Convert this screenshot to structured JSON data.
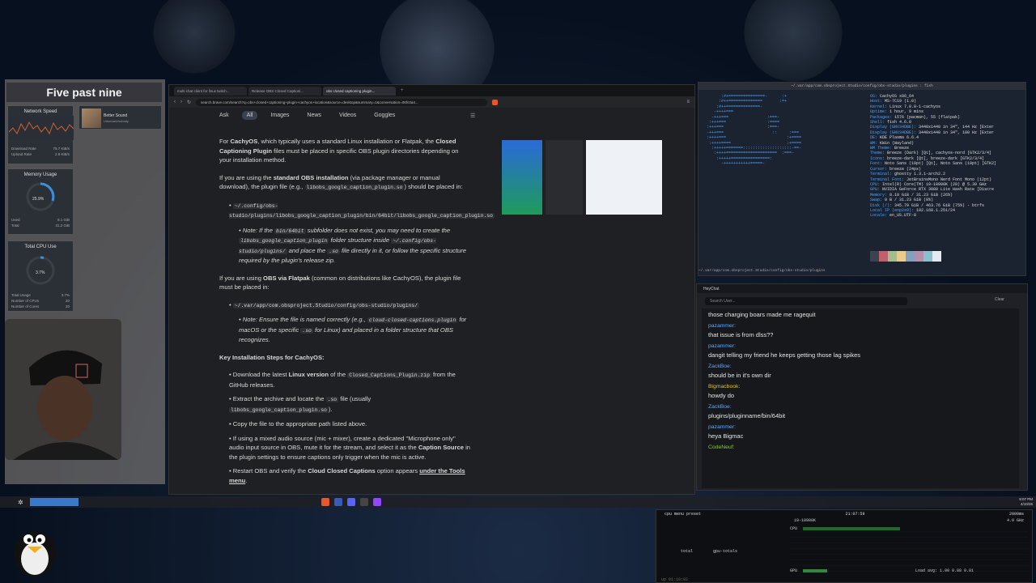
{
  "clock": "Five past nine",
  "network": {
    "title": "Network Speed",
    "download_label": "Download Rate",
    "download_value": "75.7 KiB/s",
    "upload_label": "Upload Rate",
    "upload_value": "2.8 KiB/s"
  },
  "music": {
    "title": "Better Sound",
    "subtitle": "Unknown/nobody"
  },
  "memory": {
    "title": "Memory Usage",
    "percent": "25.9%",
    "used_label": "Used",
    "used_value": "8.1 GiB",
    "total_label": "Total",
    "total_value": "31.2 GiB"
  },
  "cpu_widget": {
    "title": "Total CPU Use",
    "percent": "3.7%",
    "rows": [
      {
        "label": "Total Usage",
        "value": "3.7%"
      },
      {
        "label": "Number of CPUs",
        "value": "20"
      },
      {
        "label": "Number of Cores",
        "value": "20"
      }
    ]
  },
  "browser": {
    "tabs": [
      "multi chat client for linux twitch...",
      "Release OBS Closed Captioni...",
      "obs closed captioning plugin..."
    ],
    "url": "search.brave.com/search?q=obs+closed+captioning+plugin+cachyos+location&source=desktop&summary=1&conversation=06fc0a4...",
    "nav": [
      "Ask",
      "All",
      "Images",
      "News",
      "Videos",
      "Goggles"
    ],
    "article": {
      "p1_pre": "For ",
      "p1_b1": "CachyOS",
      "p1_mid": ", which typically uses a standard Linux installation or Flatpak, the ",
      "p1_b2": "Closed Captioning Plugin",
      "p1_post": " files must be placed in specific OBS plugin directories depending on your installation method.",
      "p2_pre": "If you are using the ",
      "p2_b": "standard OBS installation",
      "p2_mid": " (via package manager or manual download), the plugin file (e.g., ",
      "p2_code": "libobs_google_caption_plugin.so",
      "p2_post": ") should be placed in:",
      "b1_code": "~/.config/obs-studio/plugins/libobs_google_caption_plugin/bin/64bit/libobs_google_caption_plugin.so",
      "n1_a": "Note: If the ",
      "n1_c1": "bin/64bit",
      "n1_b": " subfolder does not exist, you may need to create the ",
      "n1_c2": "libobs_google_caption_plugin",
      "n1_c": " folder structure inside ",
      "n1_c3": "~/.config/obs-studio/plugins/",
      "n1_d": " and place the ",
      "n1_c4": ".so",
      "n1_e": " file directly in it, or follow the specific structure required by the plugin's release zip.",
      "p3_pre": "If you are using ",
      "p3_b": "OBS via Flatpak",
      "p3_post": " (common on distributions like CachyOS), the plugin file must be placed in:",
      "b2_code": "~/.var/app/com.obsproject.Studio/config/obs-studio/plugins/",
      "n2_a": "Note: Ensure the file is named correctly (e.g., ",
      "n2_c1": "cloud-closed-captions.plugin",
      "n2_b": " for macOS or the specific ",
      "n2_c2": ".so",
      "n2_c": " for Linux) and placed in a folder structure that OBS recognizes.",
      "steps_title": "Key Installation Steps for CachyOS:",
      "s1_a": "Download the latest ",
      "s1_b": "Linux version",
      "s1_c": " of the ",
      "s1_code": "Closed_Captions_Plugin.zip",
      "s1_d": " from the GitHub releases.",
      "s2_a": "Extract the archive and locate the ",
      "s2_c1": ".so",
      "s2_b": " file (usually ",
      "s2_c2": "libobs_google_caption_plugin.so",
      "s2_d": ").",
      "s3": "Copy the file to the appropriate path listed above.",
      "s4_a": "If using a mixed audio source (mic + mixer), create a dedicated \"Microphone only\" audio input source in OBS, mute it for the stream, and select it as the ",
      "s4_b": "Caption Source",
      "s4_c": " in the plugin settings to ensure captions only trigger when the mic is active.",
      "s5_a": "Restart OBS and verify the ",
      "s5_b": "Cloud Closed Captions",
      "s5_c": " option appears ",
      "s5_u": "under the Tools menu",
      "s5_d": "."
    }
  },
  "terminal": {
    "title": "~/.var/app/com.obsproject.Studio/config/obs-studio/plugins : fish",
    "info": [
      [
        "OS:",
        "CachyOS x86_64"
      ],
      [
        "Host:",
        "MS-7C19 (1.0)"
      ],
      [
        "Kernel:",
        "Linux 7.0.0-1-cachyos"
      ],
      [
        "Uptime:",
        "1 hour, 9 mins"
      ],
      [
        "Packages:",
        "1576 (pacman), 55 (flatpak)"
      ],
      [
        "Shell:",
        "fish 4.6.0"
      ],
      [
        "Display (GNV34DBE):",
        "3440x1440 in 34\", 144 Hz [Exter"
      ],
      [
        "Display (GNV34DBE):",
        "3440x1440 in 34\", 100 Hz [Exter"
      ],
      [
        "DE:",
        "KDE Plasma 6.6.4"
      ],
      [
        "WM:",
        "KWin (Wayland)"
      ],
      [
        "WM Theme:",
        "Breeze"
      ],
      [
        "Theme:",
        "Breeze (Dark) [Qt], cachyos-nord [GTK2/3/4]"
      ],
      [
        "Icons:",
        "breeze-dark [Qt], breeze-dark [GTK2/3/4]"
      ],
      [
        "Font:",
        "Noto Sans (10pt) [Qt], Noto Sans (10pt) [GTK2]"
      ],
      [
        "Cursor:",
        "breeze (24px)"
      ],
      [
        "Terminal:",
        "ghostty 1.3.1-arch2.2"
      ],
      [
        "Terminal Font:",
        "JetBrainsMono Nerd Font Mono (12pt)"
      ],
      [
        "CPU:",
        "Intel(R) Core(TM) i9-10900K (20) @ 5.30 GHz"
      ],
      [
        "GPU:",
        "NVIDIA GeForce RTX 3080 Lite Hash Rate [Discre"
      ],
      [
        "Memory:",
        "8.10 GiB / 31.23 GiB (26%)"
      ],
      [
        "Swap:",
        "0 B / 31.23 GiB (0%)"
      ],
      [
        "Disk (/):",
        "345.79 GiB / 463.76 GiB (75%) - btrfs"
      ],
      [
        "Local IP (enp2s0):",
        "192.168.1.251/24"
      ],
      [
        "Locale:",
        "en_US.UTF-8"
      ]
    ],
    "palette": [
      "#3b4252",
      "#bf616a",
      "#a3be8c",
      "#ebcb8b",
      "#81a1c1",
      "#b48ead",
      "#88c0d0",
      "#e5e9f0"
    ],
    "prompt": "~/.var/app/com.obsproject.Studio/config/obs-studio/plugins"
  },
  "chat": {
    "title": "HeyChat",
    "search_placeholder": "Search User...",
    "clear_label": "Clear",
    "messages": [
      {
        "user": "",
        "text": "those charging boars made me ragequit",
        "color": "#ccc"
      },
      {
        "user": "pazammer:",
        "text": "that issue is from dlss??",
        "color": "#5fa8ff"
      },
      {
        "user": "pazammer:",
        "text": "dangit telling my friend he keeps getting those lag spikes",
        "color": "#5fa8ff"
      },
      {
        "user": "ZackBoe:",
        "text": "should be in it's own dir",
        "color": "#5fa8ff"
      },
      {
        "user": "Bigmacbook:",
        "text": "howdy do",
        "color": "#e3c31c"
      },
      {
        "user": "ZackBoe:",
        "text": "plugins/pluginname/bin/64bit",
        "color": "#5fa8ff"
      },
      {
        "user": "pazammer:",
        "text": "heya Bigmac",
        "color": "#5fa8ff"
      },
      {
        "user": "CodeNeuf:",
        "text": "",
        "color": "#8bc34a"
      }
    ]
  },
  "tray": {
    "time": "9:07 PM",
    "date": "4/10/26"
  },
  "btop": {
    "menu": "cpu  menu  preset",
    "time": "21:07:59",
    "rate": "2000ms",
    "cpu_model": "i9-10900K",
    "ghz": "4.9 GHz",
    "cpu_label": "CPU",
    "gpu_label": "GPU",
    "total_label": "total",
    "gpu_totals": "gpu-totals",
    "load": "Load avg: 1.00 0.88 0.81",
    "uptime": "up 01:10:02"
  }
}
